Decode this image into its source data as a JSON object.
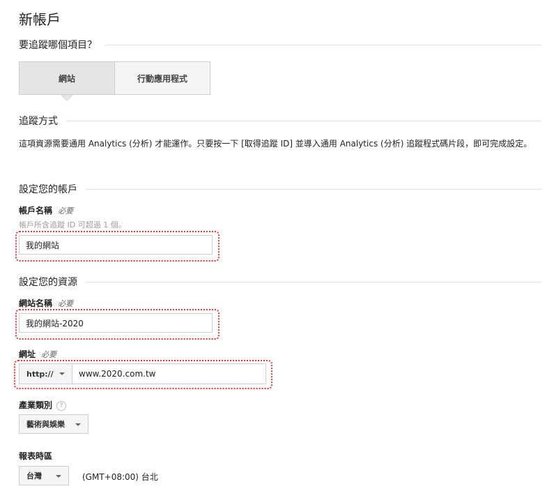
{
  "page": {
    "title": "新帳戶"
  },
  "tracking_target": {
    "heading": "要追蹤哪個項目？",
    "options": [
      {
        "label": "網站",
        "selected": true
      },
      {
        "label": "行動應用程式",
        "selected": false
      }
    ]
  },
  "tracking_method": {
    "heading": "追蹤方式",
    "description": "這項資源需要通用 Analytics (分析) 才能運作。只要按一下 [取得追蹤 ID] 並導入通用 Analytics (分析) 追蹤程式碼片段，即可完成設定。"
  },
  "account_setup": {
    "heading": "設定您的帳戶",
    "account_name": {
      "label": "帳戶名稱",
      "required": "必要",
      "hint": "帳戶所含追蹤 ID 可超過 1 個。",
      "value": "我的網站"
    }
  },
  "property_setup": {
    "heading": "設定您的資源",
    "site_name": {
      "label": "網站名稱",
      "required": "必要",
      "value": "我的網站-2020"
    },
    "url": {
      "label": "網址",
      "required": "必要",
      "protocol": "http://",
      "value": "www.2020.com.tw"
    },
    "industry": {
      "label": "產業類別",
      "help": "?",
      "value": "藝術與娛樂"
    },
    "timezone": {
      "label": "報表時區",
      "country": "台灣",
      "zone": "(GMT+08:00) 台北"
    }
  },
  "colors": {
    "highlight": "#e53935",
    "border": "#cfcfcf",
    "rule": "#e0e0e0"
  }
}
